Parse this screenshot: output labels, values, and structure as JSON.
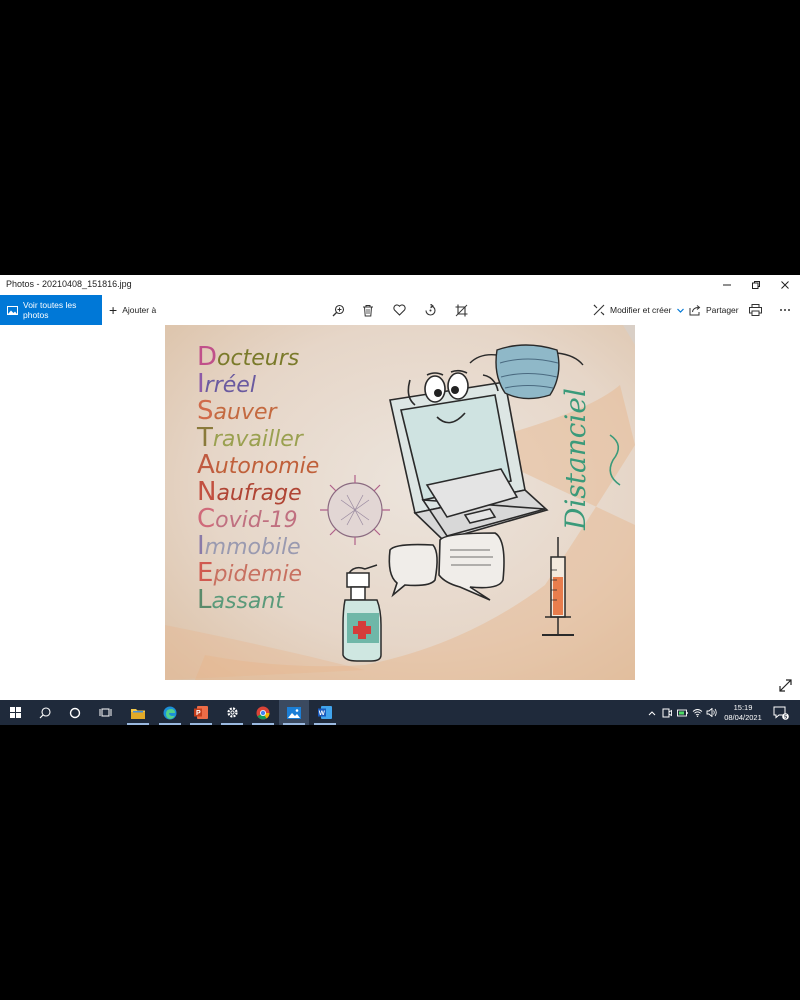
{
  "window": {
    "title": "Photos - 20210408_151816.jpg"
  },
  "toolbar": {
    "all_photos_label": "Voir toutes les photos",
    "add_to_label": "Ajouter à",
    "edit_create_label": "Modifier et créer",
    "share_label": "Partager"
  },
  "photo": {
    "acrostic": [
      {
        "initial": "D",
        "rest": "octeurs",
        "color": "#c0508a",
        "rest_color": "#7a7a2a"
      },
      {
        "initial": "I",
        "rest": "rréel",
        "color": "#8c5aa8",
        "rest_color": "#6a5aa0"
      },
      {
        "initial": "S",
        "rest": "auver",
        "color": "#d06a4a",
        "rest_color": "#c46a40"
      },
      {
        "initial": "T",
        "rest": "ravailler",
        "color": "#8a7a3a",
        "rest_color": "#9aa050"
      },
      {
        "initial": "A",
        "rest": "utonomie",
        "color": "#c05a40",
        "rest_color": "#c0603a"
      },
      {
        "initial": "N",
        "rest": "aufrage",
        "color": "#c25040",
        "rest_color": "#b04535"
      },
      {
        "initial": "C",
        "rest": "ovid-19",
        "color": "#d06a7a",
        "rest_color": "#c07080"
      },
      {
        "initial": "I",
        "rest": "mmobile",
        "color": "#8a7aa8",
        "rest_color": "#9a9ab0"
      },
      {
        "initial": "E",
        "rest": "pidemie",
        "color": "#d05a50",
        "rest_color": "#c87060"
      },
      {
        "initial": "L",
        "rest": "assant",
        "color": "#5a8a6a",
        "rest_color": "#5a9a7a"
      }
    ],
    "vertical_word": "Distanciel",
    "vertical_color": "#3a9a7a"
  },
  "taskbar": {
    "time": "15:19",
    "date": "08/04/2021",
    "notification_count": "5"
  },
  "colors": {
    "accent": "#0078d7",
    "taskbar": "#1f2a3b"
  }
}
